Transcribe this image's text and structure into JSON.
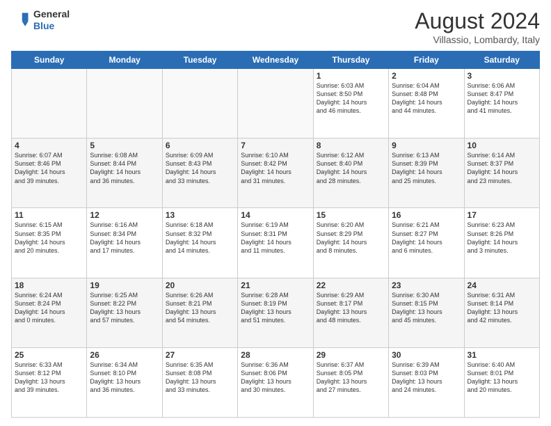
{
  "header": {
    "logo": {
      "line1": "General",
      "line2": "Blue"
    },
    "title": "August 2024",
    "subtitle": "Villassio, Lombardy, Italy"
  },
  "days_of_week": [
    "Sunday",
    "Monday",
    "Tuesday",
    "Wednesday",
    "Thursday",
    "Friday",
    "Saturday"
  ],
  "weeks": [
    [
      {
        "day": "",
        "info": ""
      },
      {
        "day": "",
        "info": ""
      },
      {
        "day": "",
        "info": ""
      },
      {
        "day": "",
        "info": ""
      },
      {
        "day": "1",
        "info": "Sunrise: 6:03 AM\nSunset: 8:50 PM\nDaylight: 14 hours\nand 46 minutes."
      },
      {
        "day": "2",
        "info": "Sunrise: 6:04 AM\nSunset: 8:48 PM\nDaylight: 14 hours\nand 44 minutes."
      },
      {
        "day": "3",
        "info": "Sunrise: 6:06 AM\nSunset: 8:47 PM\nDaylight: 14 hours\nand 41 minutes."
      }
    ],
    [
      {
        "day": "4",
        "info": "Sunrise: 6:07 AM\nSunset: 8:46 PM\nDaylight: 14 hours\nand 39 minutes."
      },
      {
        "day": "5",
        "info": "Sunrise: 6:08 AM\nSunset: 8:44 PM\nDaylight: 14 hours\nand 36 minutes."
      },
      {
        "day": "6",
        "info": "Sunrise: 6:09 AM\nSunset: 8:43 PM\nDaylight: 14 hours\nand 33 minutes."
      },
      {
        "day": "7",
        "info": "Sunrise: 6:10 AM\nSunset: 8:42 PM\nDaylight: 14 hours\nand 31 minutes."
      },
      {
        "day": "8",
        "info": "Sunrise: 6:12 AM\nSunset: 8:40 PM\nDaylight: 14 hours\nand 28 minutes."
      },
      {
        "day": "9",
        "info": "Sunrise: 6:13 AM\nSunset: 8:39 PM\nDaylight: 14 hours\nand 25 minutes."
      },
      {
        "day": "10",
        "info": "Sunrise: 6:14 AM\nSunset: 8:37 PM\nDaylight: 14 hours\nand 23 minutes."
      }
    ],
    [
      {
        "day": "11",
        "info": "Sunrise: 6:15 AM\nSunset: 8:35 PM\nDaylight: 14 hours\nand 20 minutes."
      },
      {
        "day": "12",
        "info": "Sunrise: 6:16 AM\nSunset: 8:34 PM\nDaylight: 14 hours\nand 17 minutes."
      },
      {
        "day": "13",
        "info": "Sunrise: 6:18 AM\nSunset: 8:32 PM\nDaylight: 14 hours\nand 14 minutes."
      },
      {
        "day": "14",
        "info": "Sunrise: 6:19 AM\nSunset: 8:31 PM\nDaylight: 14 hours\nand 11 minutes."
      },
      {
        "day": "15",
        "info": "Sunrise: 6:20 AM\nSunset: 8:29 PM\nDaylight: 14 hours\nand 8 minutes."
      },
      {
        "day": "16",
        "info": "Sunrise: 6:21 AM\nSunset: 8:27 PM\nDaylight: 14 hours\nand 6 minutes."
      },
      {
        "day": "17",
        "info": "Sunrise: 6:23 AM\nSunset: 8:26 PM\nDaylight: 14 hours\nand 3 minutes."
      }
    ],
    [
      {
        "day": "18",
        "info": "Sunrise: 6:24 AM\nSunset: 8:24 PM\nDaylight: 14 hours\nand 0 minutes."
      },
      {
        "day": "19",
        "info": "Sunrise: 6:25 AM\nSunset: 8:22 PM\nDaylight: 13 hours\nand 57 minutes."
      },
      {
        "day": "20",
        "info": "Sunrise: 6:26 AM\nSunset: 8:21 PM\nDaylight: 13 hours\nand 54 minutes."
      },
      {
        "day": "21",
        "info": "Sunrise: 6:28 AM\nSunset: 8:19 PM\nDaylight: 13 hours\nand 51 minutes."
      },
      {
        "day": "22",
        "info": "Sunrise: 6:29 AM\nSunset: 8:17 PM\nDaylight: 13 hours\nand 48 minutes."
      },
      {
        "day": "23",
        "info": "Sunrise: 6:30 AM\nSunset: 8:15 PM\nDaylight: 13 hours\nand 45 minutes."
      },
      {
        "day": "24",
        "info": "Sunrise: 6:31 AM\nSunset: 8:14 PM\nDaylight: 13 hours\nand 42 minutes."
      }
    ],
    [
      {
        "day": "25",
        "info": "Sunrise: 6:33 AM\nSunset: 8:12 PM\nDaylight: 13 hours\nand 39 minutes."
      },
      {
        "day": "26",
        "info": "Sunrise: 6:34 AM\nSunset: 8:10 PM\nDaylight: 13 hours\nand 36 minutes."
      },
      {
        "day": "27",
        "info": "Sunrise: 6:35 AM\nSunset: 8:08 PM\nDaylight: 13 hours\nand 33 minutes."
      },
      {
        "day": "28",
        "info": "Sunrise: 6:36 AM\nSunset: 8:06 PM\nDaylight: 13 hours\nand 30 minutes."
      },
      {
        "day": "29",
        "info": "Sunrise: 6:37 AM\nSunset: 8:05 PM\nDaylight: 13 hours\nand 27 minutes."
      },
      {
        "day": "30",
        "info": "Sunrise: 6:39 AM\nSunset: 8:03 PM\nDaylight: 13 hours\nand 24 minutes."
      },
      {
        "day": "31",
        "info": "Sunrise: 6:40 AM\nSunset: 8:01 PM\nDaylight: 13 hours\nand 20 minutes."
      }
    ]
  ]
}
